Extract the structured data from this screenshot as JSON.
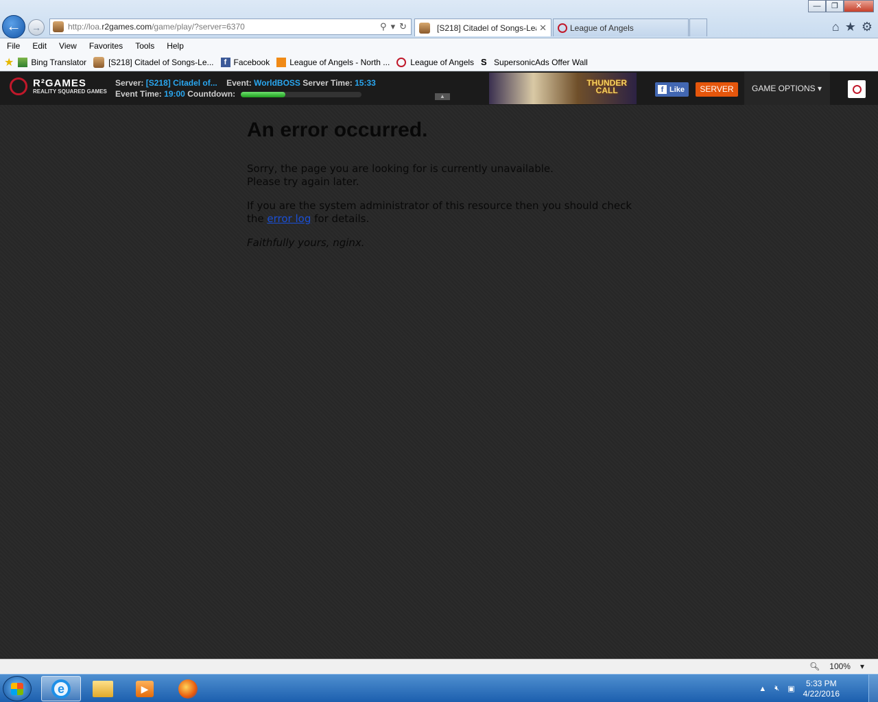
{
  "browser": {
    "address": {
      "prefix": "http://loa.",
      "domain": "r2games.com",
      "path": "/game/play/?server=6370"
    },
    "tabs": [
      {
        "label": "[S218] Citadel of Songs-Lea...",
        "active": true
      },
      {
        "label": "League of Angels",
        "active": false
      }
    ],
    "window_controls": {
      "minimize": "—",
      "restore": "❐",
      "close": "✕"
    },
    "nav": {
      "back": "←",
      "forward": "→"
    },
    "right_icons": {
      "home": "⌂",
      "favorites": "★",
      "tools": "⚙"
    }
  },
  "menu": [
    "File",
    "Edit",
    "View",
    "Favorites",
    "Tools",
    "Help"
  ],
  "favorites_bar": [
    {
      "label": "Bing Translator",
      "icon": "translator-icon"
    },
    {
      "label": "[S218] Citadel of Songs-Le...",
      "icon": "game-tab-icon"
    },
    {
      "label": "Facebook",
      "icon": "facebook-icon"
    },
    {
      "label": "League of Angels - North ...",
      "icon": "orange-game-icon"
    },
    {
      "label": "League of Angels",
      "icon": "r2-icon"
    },
    {
      "label": "SupersonicAds Offer Wall",
      "icon": "supersonic-icon"
    }
  ],
  "game_header": {
    "logo_title": "R²GAMES",
    "logo_subtitle": "REALITY SQUARED GAMES",
    "server_label": "Server:",
    "server_value": "[S218] Citadel of...",
    "event_label": "Event:",
    "event_value": "WorldBOSS",
    "server_time_label": "Server Time:",
    "server_time_value": "15:33",
    "event_time_label": "Event Time:",
    "event_time_value": "19:00",
    "countdown_label": "Countdown:",
    "countdown_progress": 0.37,
    "banner_text_line1": "THUNDER",
    "banner_text_line2": "CALL",
    "like_label": "Like",
    "server_button": "SERVER",
    "game_options": "GAME OPTIONS ▾"
  },
  "error_page": {
    "title": "An error occurred.",
    "line1": "Sorry, the page you are looking for is currently unavailable.",
    "line2": "Please try again later.",
    "admin_text": "If you are the system administrator of this resource then you should check the",
    "link": "error log",
    "admin_tail": " for details.",
    "signature": "Faithfully yours, nginx."
  },
  "status_bar": {
    "zoom": "100%"
  },
  "taskbar": {
    "time": "5:33 PM",
    "date": "4/22/2016"
  },
  "colors": {
    "accent_blue": "#2aa7f0",
    "server_orange": "#e5560c",
    "facebook_blue": "#4267b2",
    "link": "#1a4fd6"
  }
}
